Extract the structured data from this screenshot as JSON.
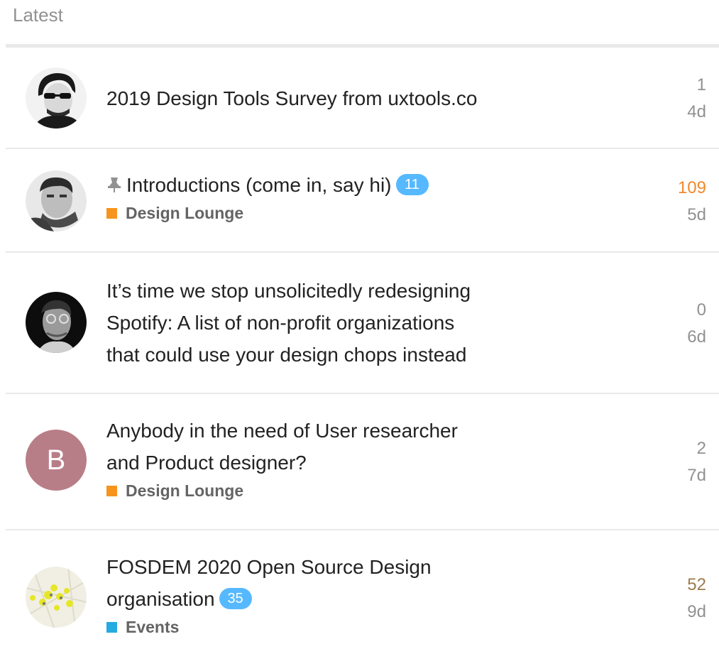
{
  "section": {
    "heading": "Latest"
  },
  "colors": {
    "category_design_lounge": "#f7941d",
    "category_events": "#25aae1",
    "unread_badge": "#56b9ff",
    "hot_count": "#f0892d",
    "warm_count": "#9c7b4a",
    "avatar_letter_bg": "#b87e87"
  },
  "topics": [
    {
      "title": "2019 Design Tools Survey from uxtools.co",
      "pinned": false,
      "unread": "",
      "category": "",
      "count": "1",
      "age": "4d",
      "avatar": "user-photo-sunglasses"
    },
    {
      "title": "Introductions (come in, say hi)",
      "pinned": true,
      "unread": "11",
      "category": "Design Lounge",
      "count": "109",
      "age": "5d",
      "avatar": "user-photo-hand-on-chin"
    },
    {
      "title": "It’s time we stop unsolicitedly redesigning Spotify: A list of non-profit organizations that could use your design chops instead",
      "title_lines": [
        "It’s time we stop unsolicitedly redesigning",
        "Spotify: A list of non-profit organizations",
        "that could use your design chops instead"
      ],
      "pinned": false,
      "unread": "",
      "category": "",
      "count": "0",
      "age": "6d",
      "avatar": "user-photo-glasses-looking-up"
    },
    {
      "title": "Anybody in the need of User researcher and Product designer?",
      "title_lines": [
        "Anybody in the need of User researcher",
        "and Product designer?"
      ],
      "pinned": false,
      "unread": "",
      "category": "Design Lounge",
      "count": "2",
      "age": "7d",
      "avatar": "letter-avatar",
      "avatar_letter": "B"
    },
    {
      "title": "FOSDEM 2020 Open Source Design organisation",
      "title_lines": [
        "FOSDEM 2020 Open Source Design",
        "organisation"
      ],
      "pinned": false,
      "unread": "35",
      "category": "Events",
      "count": "52",
      "age": "9d",
      "avatar": "map-pins-image"
    }
  ]
}
